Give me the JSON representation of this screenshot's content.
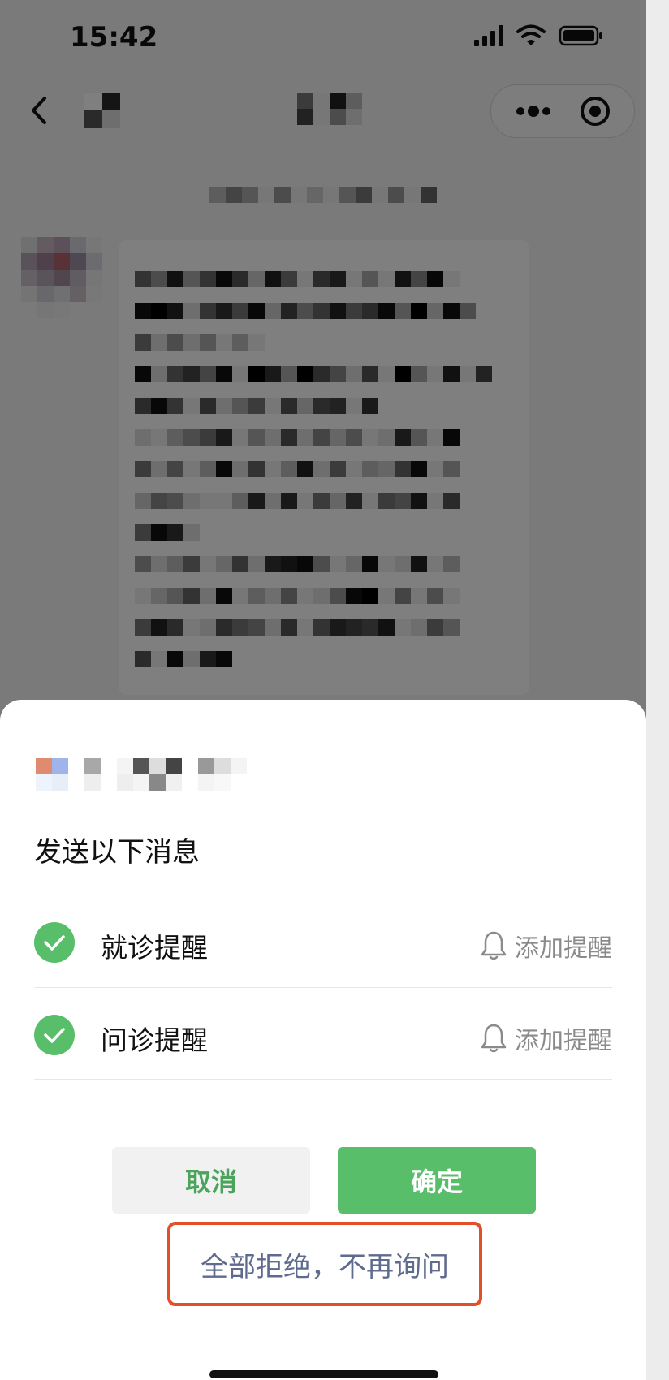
{
  "status_bar": {
    "time": "15:42",
    "icons": [
      "cellular-signal-icon",
      "wifi-icon",
      "battery-icon"
    ]
  },
  "nav": {
    "icons": [
      "back-chevron-icon",
      "more-dots-icon",
      "target-record-icon"
    ]
  },
  "colors": {
    "accent_green": "#58be6a",
    "cancel_text_green": "#4aa55a",
    "highlight_red": "#e2502a",
    "link_blue_gray": "#5f6a8f"
  },
  "sheet": {
    "title": "发送以下消息",
    "items": [
      {
        "label": "就诊提醒",
        "action": "添加提醒",
        "checked": true
      },
      {
        "label": "问诊提醒",
        "action": "添加提醒",
        "checked": true
      }
    ],
    "cancel_label": "取消",
    "confirm_label": "确定",
    "reject_all_label": "全部拒绝，不再询问"
  }
}
